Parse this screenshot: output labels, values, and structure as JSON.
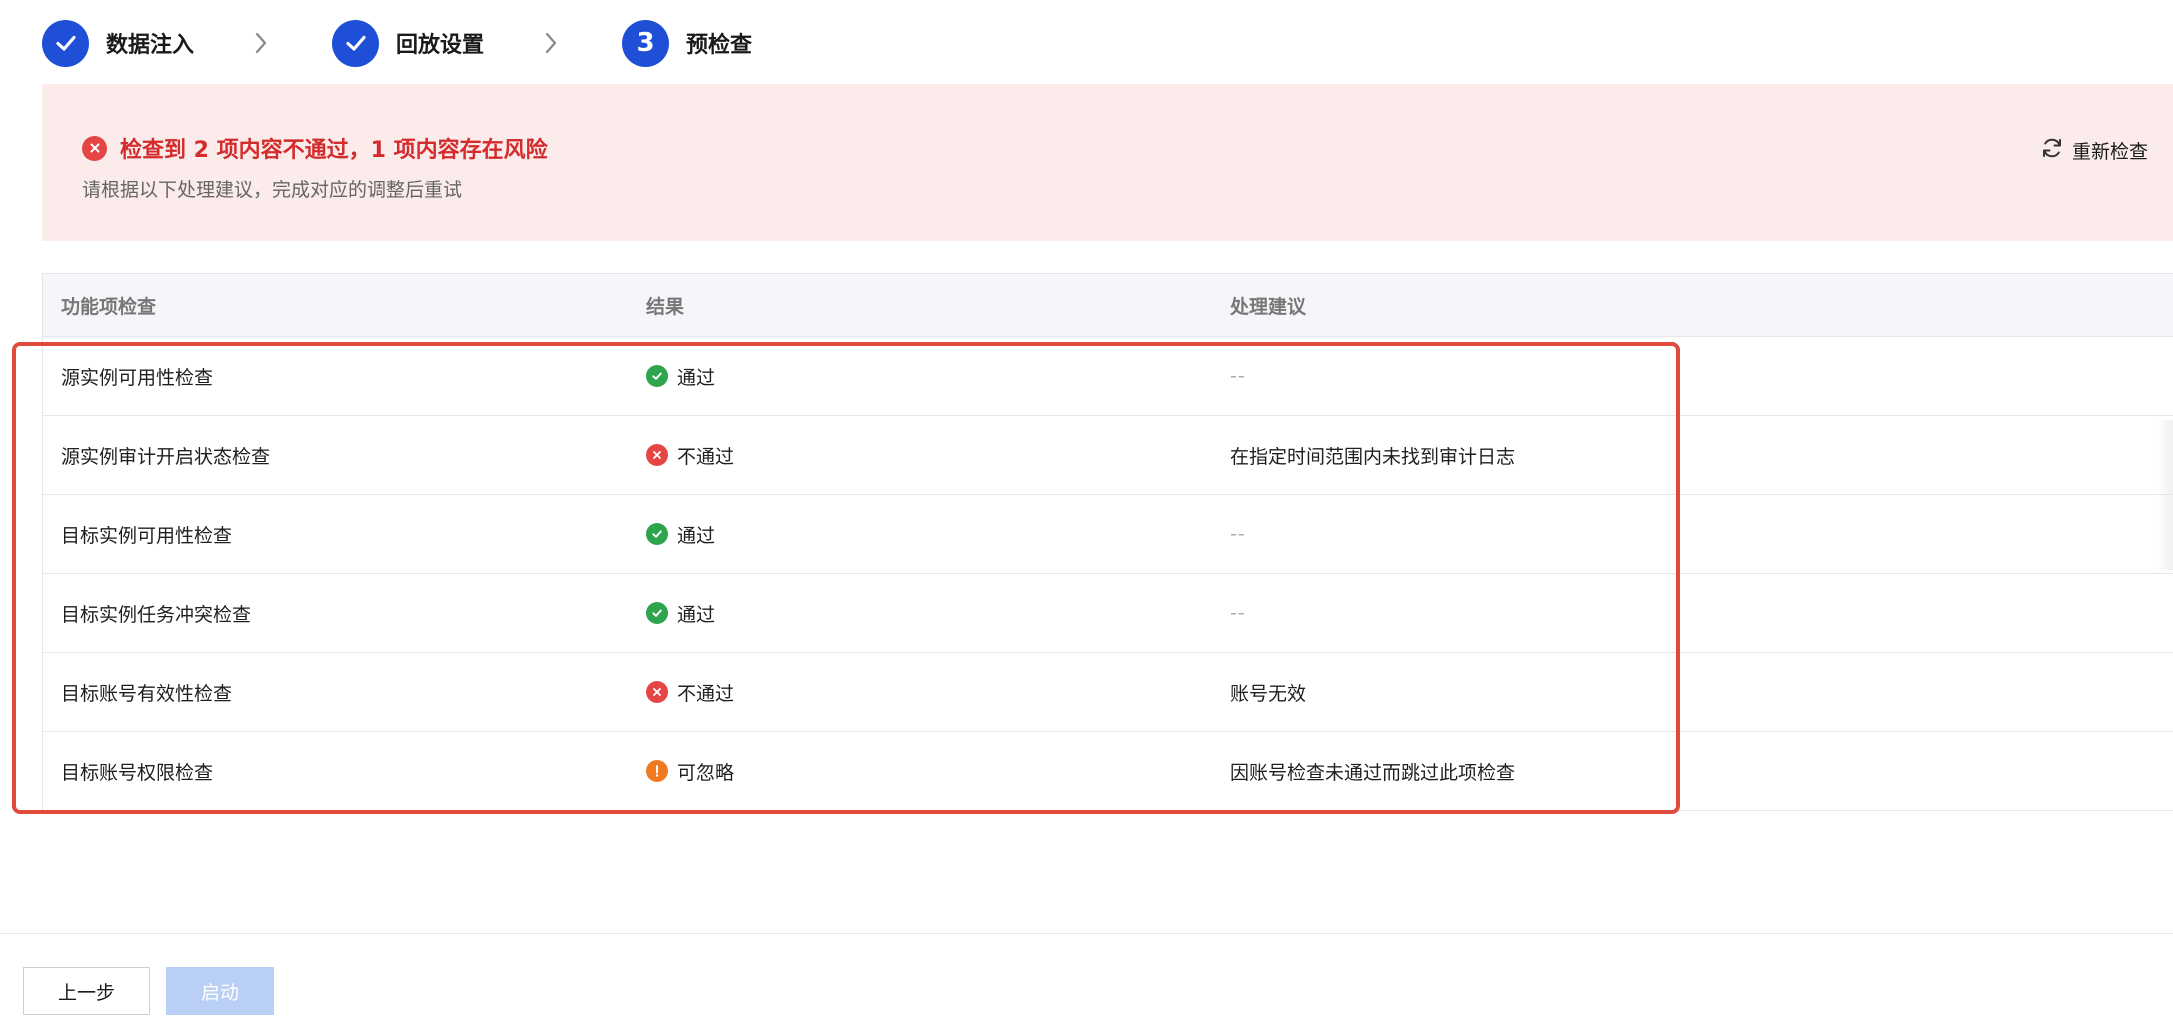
{
  "steps": [
    {
      "label": "数据注入",
      "state": "done"
    },
    {
      "label": "回放设置",
      "state": "done"
    },
    {
      "label": "预检查",
      "state": "active",
      "number": "3"
    }
  ],
  "alert": {
    "title": "检查到 2 项内容不通过，1 项内容存在风险",
    "description": "请根据以下处理建议，完成对应的调整后重试",
    "recheck_label": "重新检查",
    "colors": {
      "background": "#fbebeb",
      "title": "#d42c2c",
      "icon": "#e54545"
    }
  },
  "table": {
    "headers": [
      "功能项检查",
      "结果",
      "处理建议"
    ],
    "rows": [
      {
        "item": "源实例可用性检查",
        "status": "ok",
        "result": "通过",
        "advice": "--"
      },
      {
        "item": "源实例审计开启状态检查",
        "status": "fail",
        "result": "不通过",
        "advice": "在指定时间范围内未找到审计日志"
      },
      {
        "item": "目标实例可用性检查",
        "status": "ok",
        "result": "通过",
        "advice": "--"
      },
      {
        "item": "目标实例任务冲突检查",
        "status": "ok",
        "result": "通过",
        "advice": "--"
      },
      {
        "item": "目标账号有效性检查",
        "status": "fail",
        "result": "不通过",
        "advice": "账号无效"
      },
      {
        "item": "目标账号权限检查",
        "status": "warn",
        "result": "可忽略",
        "advice": "因账号检查未通过而跳过此项检查"
      }
    ]
  },
  "footer": {
    "prev_label": "上一步",
    "start_label": "启动"
  },
  "colors": {
    "primary": "#1f4fd6",
    "ok": "#2fa44f",
    "fail": "#e54545",
    "warn": "#ef7a22",
    "highlight": "#df4b3c"
  }
}
